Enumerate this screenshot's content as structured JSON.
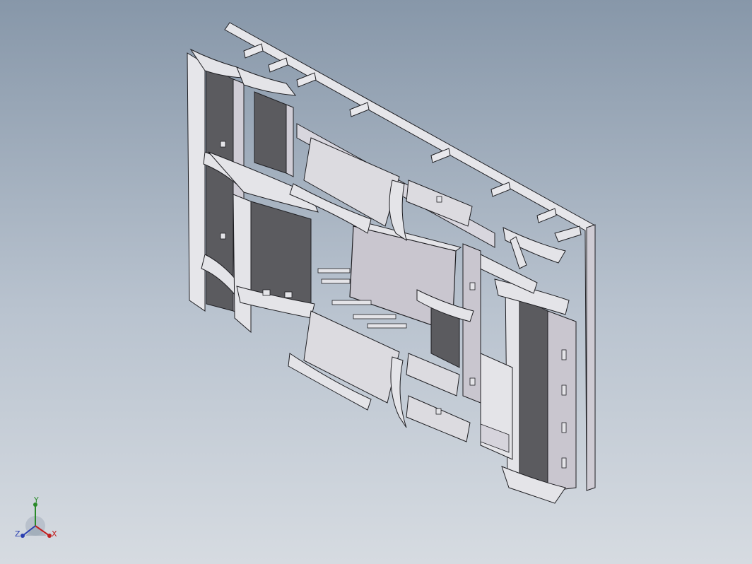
{
  "viewport": {
    "background_top": "#8797a9",
    "background_bottom": "#d6dbe1"
  },
  "model": {
    "icon": "isometric-frame-assembly",
    "colors": {
      "light_face": "#e4e4e8",
      "mid_face": "#c9c6cf",
      "dark_face": "#5b5b5f",
      "edge": "#1e1e22"
    }
  },
  "triad": {
    "x_label": "X",
    "y_label": "Y",
    "z_label": "Z",
    "x_color": "#c02020",
    "y_color": "#2a8a2a",
    "z_color": "#2a3fb0"
  }
}
